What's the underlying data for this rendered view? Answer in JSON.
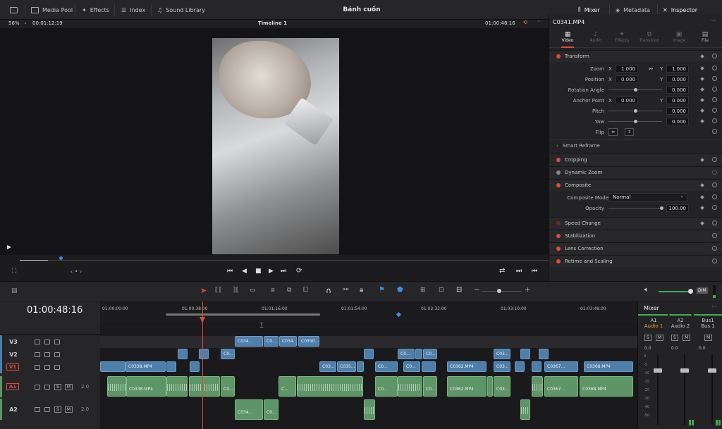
{
  "topbar": {
    "media_pool": "Media Pool",
    "effects": "Effects",
    "index": "Index",
    "sound_library": "Sound Library",
    "project_title": "Bánh cuốn",
    "mixer": "Mixer",
    "metadata": "Metadata",
    "inspector": "Inspector"
  },
  "viewer": {
    "zoom": "56%",
    "source_timecode": "00:01:12:19",
    "timeline_name": "Timeline 1",
    "record_timecode": "01:00:48:16"
  },
  "inspector": {
    "clip_name": "C0341.MP4",
    "tabs": [
      "Video",
      "Audio",
      "Effects",
      "Transition",
      "Image",
      "File"
    ],
    "transform_title": "Transform",
    "zoom_label": "Zoom",
    "zoom_x": "1.000",
    "zoom_y": "1.000",
    "position_label": "Position",
    "position_x": "0.000",
    "position_y": "0.000",
    "rotation_label": "Rotation Angle",
    "rotation_value": "0.000",
    "anchor_label": "Anchor Point",
    "anchor_x": "0.000",
    "anchor_y": "0.000",
    "pitch_label": "Pitch",
    "pitch_value": "0.000",
    "yaw_label": "Yaw",
    "yaw_value": "0.000",
    "flip_label": "Flip",
    "x_label": "X",
    "y_label": "Y",
    "smart_reframe": "Smart Reframe",
    "cropping": "Cropping",
    "dynamic_zoom": "Dynamic Zoom",
    "composite": "Composite",
    "composite_mode_label": "Composite Mode",
    "composite_mode_value": "Normal",
    "opacity_label": "Opacity",
    "opacity_value": "100.00",
    "speed_change": "Speed Change",
    "stabilization": "Stabilization",
    "lens_correction": "Lens Correction",
    "retime_scaling": "Retime and Scaling"
  },
  "timeline": {
    "timecode": "01:00:48:16",
    "ruler": [
      "01:00:00:00",
      "01:00:38:00",
      "01:01:16:00",
      "01:01:54:00",
      "01:02:32:00",
      "01:03:10:00",
      "01:03:48:00"
    ],
    "tracks": {
      "v3": "V3",
      "v2": "V2",
      "v1": "V1",
      "a1": "A1",
      "a2": "A2",
      "a1_level": "2.0",
      "a2_level": "2.0",
      "s": "S",
      "m": "M"
    },
    "v3_clips": [
      "C034...",
      "C0...",
      "C034...",
      "C0350..."
    ],
    "v2_clips": [
      "C0...",
      "C0...",
      "C0...",
      "C03..."
    ],
    "v1_clips": [
      "C0338.MP4",
      "C03...",
      "C035...",
      "C0...",
      "C0...",
      "C0362.MP4",
      "C03...",
      "C0367...",
      "C0368.MP4"
    ],
    "a1_clips": [
      "C0338.MP4",
      "C0...",
      "C...",
      "C0...",
      "C0...",
      "C0362.MP4",
      "C03...",
      "C0367...",
      "C0368.MP4"
    ],
    "a2_clips": [
      "C034...",
      "C0..."
    ]
  },
  "mixer": {
    "title": "Mixer",
    "channels": [
      {
        "name": "A1",
        "sub": "Audio 1",
        "level": "0.0"
      },
      {
        "name": "A2",
        "sub": "Audio 2",
        "level": "0.0"
      },
      {
        "name": "Bus1",
        "sub": "Bus 1",
        "level": "0.0"
      }
    ],
    "s": "S",
    "m": "M",
    "dim": "DIM",
    "scale": [
      "0",
      "-5",
      "-10",
      "-15",
      "-20",
      "-30",
      "-40",
      "-50"
    ]
  },
  "colors": {
    "accent_red": "#e04a3a",
    "video_clip": "#4e7fab",
    "audio_clip": "#5e9566",
    "timecode_orange": "#e3a23a"
  }
}
